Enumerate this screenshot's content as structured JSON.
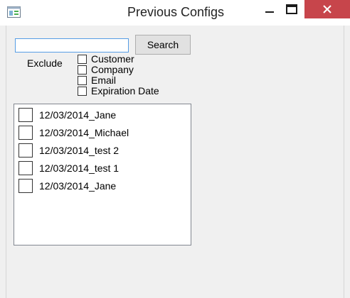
{
  "window": {
    "title": "Previous Configs",
    "close_color": "#c7454b",
    "icons": {
      "app": "window-app-icon",
      "minimize": "minimize-icon",
      "maximize": "maximize-icon",
      "close": "close-icon"
    }
  },
  "search": {
    "value": "",
    "button_label": "Search"
  },
  "exclude": {
    "label": "Exclude",
    "options": [
      {
        "label": "Customer",
        "checked": false
      },
      {
        "label": "Company",
        "checked": false
      },
      {
        "label": "Email",
        "checked": false
      },
      {
        "label": "Expiration Date",
        "checked": false
      }
    ]
  },
  "configs": {
    "items": [
      {
        "label": "12/03/2014_Jane",
        "checked": false
      },
      {
        "label": "12/03/2014_Michael",
        "checked": false
      },
      {
        "label": "12/03/2014_test 2",
        "checked": false
      },
      {
        "label": "12/03/2014_test 1",
        "checked": false
      },
      {
        "label": "12/03/2014_Jane",
        "checked": false
      }
    ]
  }
}
